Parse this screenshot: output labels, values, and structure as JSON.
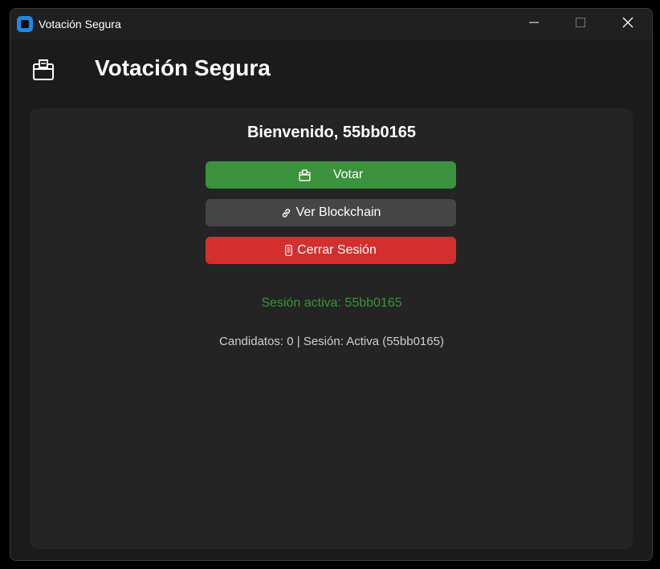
{
  "window": {
    "title": "Votación Segura",
    "controls": {
      "minimize_icon": "minimize-icon",
      "maximize_icon": "maximize-icon",
      "close_icon": "close-icon"
    }
  },
  "header": {
    "icon": "ballot-box-icon",
    "title": "Votación Segura"
  },
  "main": {
    "welcome": "Bienvenido, 55bb0165",
    "buttons": {
      "vote": {
        "label": "Votar",
        "icon": "ballot-box-icon",
        "color": "#3a923d"
      },
      "blockchain": {
        "label": "Ver Blockchain",
        "icon": "link-icon",
        "color": "#454545"
      },
      "logout": {
        "label": "Cerrar Sesión",
        "icon": "phone-icon",
        "color": "#d32f2f"
      }
    },
    "session_status": "Sesión activa: 55bb0165",
    "info": "Candidatos: 0 | Sesión: Activa (55bb0165)"
  },
  "colors": {
    "accent_green": "#3a923d",
    "danger_red": "#d32f2f",
    "background": "#1b1b1b",
    "card": "#242424"
  }
}
